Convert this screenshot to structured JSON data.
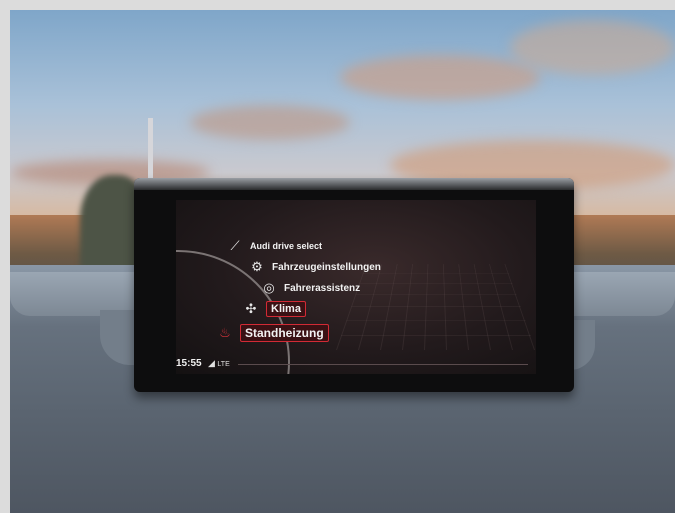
{
  "screen": {
    "menu": [
      {
        "label": "Audi drive select",
        "icon": "drive-select-icon",
        "selected": false
      },
      {
        "label": "Fahrzeugeinstellungen",
        "icon": "vehicle-settings-icon",
        "selected": false
      },
      {
        "label": "Fahrerassistenz",
        "icon": "driver-assist-icon",
        "selected": false
      },
      {
        "label": "Klima",
        "icon": "fan-icon",
        "selected": true
      },
      {
        "label": "Standheizung",
        "icon": "seat-heating-icon",
        "selected": true
      }
    ],
    "status": {
      "time": "15:55",
      "network": "LTE"
    },
    "accent_color": "#d22a35"
  }
}
